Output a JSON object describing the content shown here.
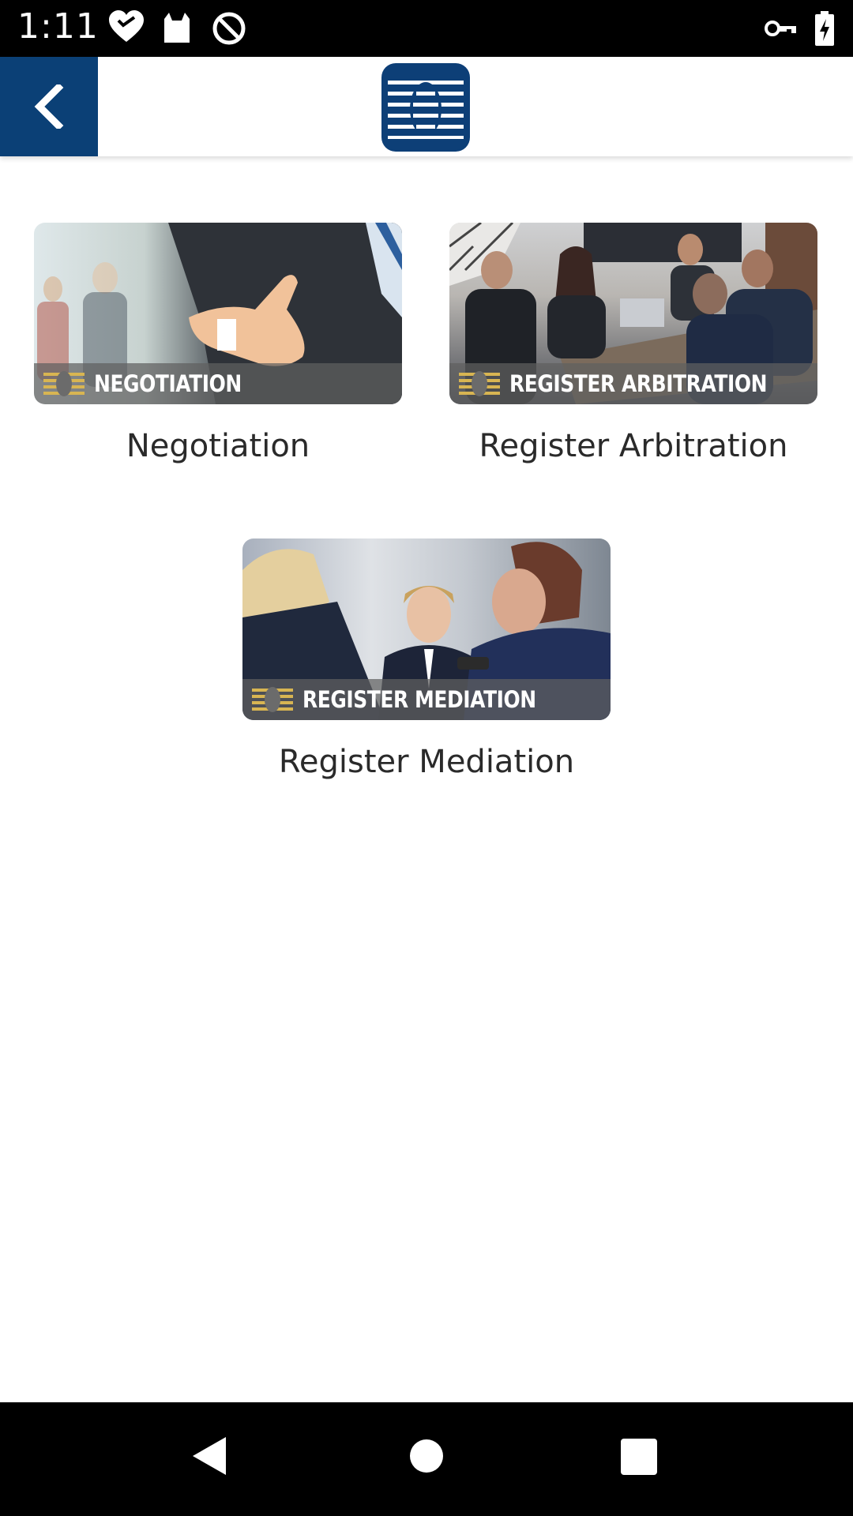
{
  "status_bar": {
    "time": "1:11",
    "icons": [
      "heart-icon",
      "cat-icon",
      "no-disturb-icon",
      "vpn-key-icon",
      "battery-charging-icon"
    ]
  },
  "app_bar": {
    "back_icon": "chevron-left-icon",
    "logo": "brand-logo",
    "accent_color": "#0b4076"
  },
  "tiles": [
    {
      "banner": "NEGOTIATION",
      "caption": "Negotiation",
      "photo": "handshake-offer-photo"
    },
    {
      "banner": "REGISTER ARBITRATION",
      "caption": "Register Arbitration",
      "photo": "arbitration-meeting-photo"
    },
    {
      "banner": "REGISTER MEDIATION",
      "caption": "Register Mediation",
      "photo": "mediation-meeting-photo"
    }
  ],
  "nav_bar": {
    "icons": [
      "nav-back-icon",
      "nav-home-icon",
      "nav-recents-icon"
    ]
  }
}
